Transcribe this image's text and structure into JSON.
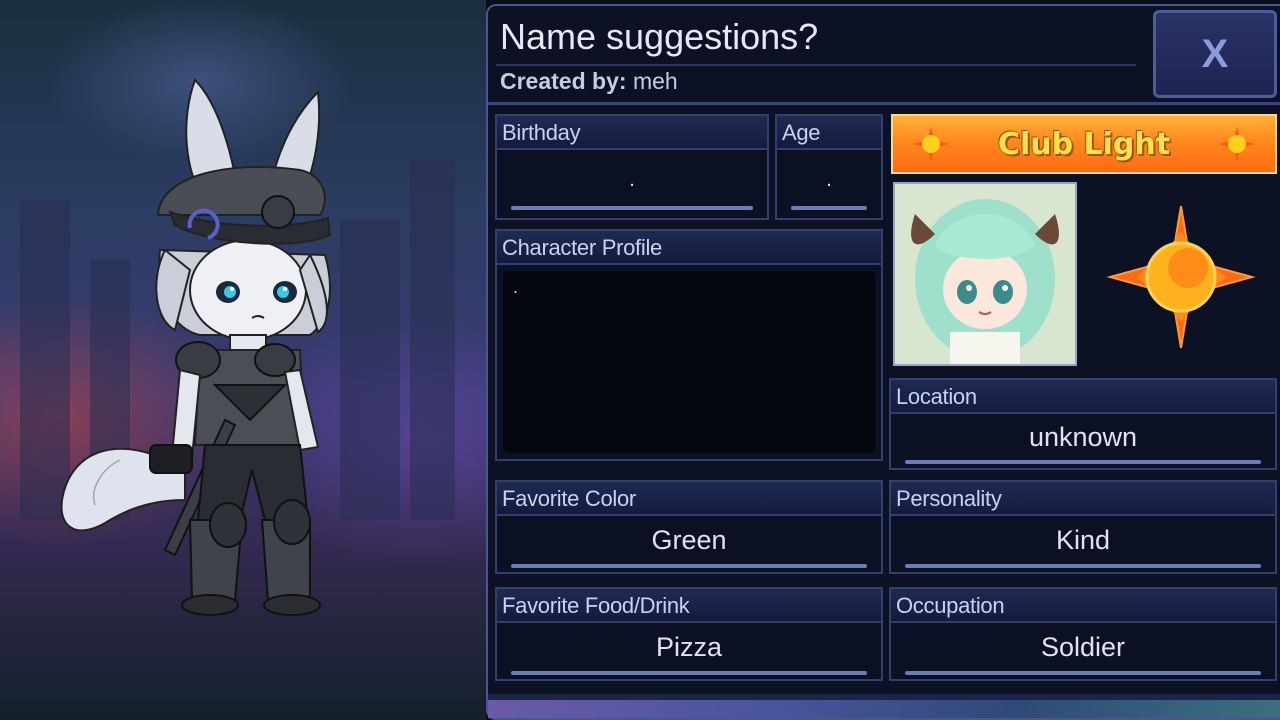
{
  "panel": {
    "title": "Name suggestions?",
    "created_by_label": "Created by:",
    "created_by_value": "meh",
    "close_label": "X"
  },
  "fields": {
    "birthday": {
      "label": "Birthday",
      "value": "."
    },
    "age": {
      "label": "Age",
      "value": "."
    },
    "profile": {
      "label": "Character Profile",
      "value": "."
    },
    "location": {
      "label": "Location",
      "value": "unknown"
    },
    "favorite_color": {
      "label": "Favorite Color",
      "value": "Green"
    },
    "personality": {
      "label": "Personality",
      "value": "Kind"
    },
    "favorite_food": {
      "label": "Favorite Food/Drink",
      "value": "Pizza"
    },
    "occupation": {
      "label": "Occupation",
      "value": "Soldier"
    }
  },
  "club": {
    "name": "Club Light",
    "icon": "sun-emblem-icon"
  },
  "colors": {
    "panel_bg": "#0c1124",
    "border": "#33406f",
    "label_text": "#c9d2f2",
    "banner_orange": "#ff8a1e",
    "banner_text": "#ffe14a"
  }
}
